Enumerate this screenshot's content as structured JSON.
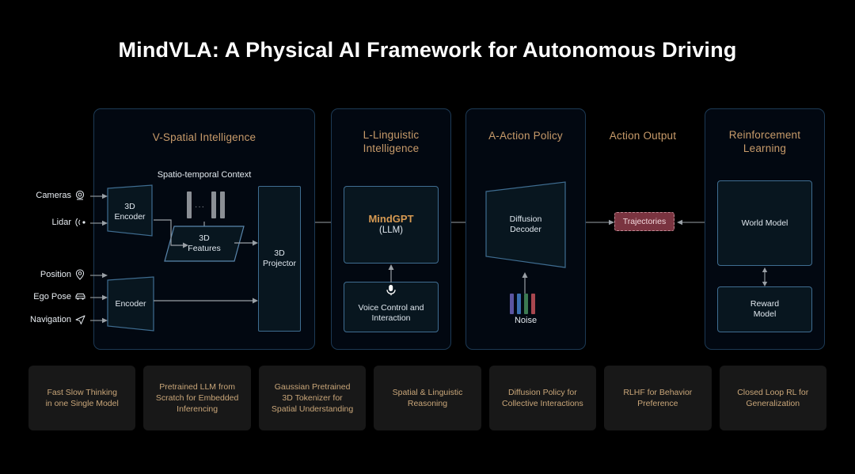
{
  "page": {
    "title": "MindVLA: A Physical AI Framework for Autonomous Driving",
    "background": "#000000"
  },
  "colors": {
    "accent_gold": "#c89b6a",
    "panel_bg": "#020811",
    "panel_border": "#1d3a55",
    "node_border": "#3f6d91",
    "node_bg": "#08161f",
    "text": "#dfe7ee",
    "trajectory_bg": "#7a3440",
    "card_bg": "#181818",
    "card_text": "#c9a679"
  },
  "inputs": [
    {
      "label": "Cameras",
      "icon": "camera-icon"
    },
    {
      "label": "Lidar",
      "icon": "lidar-icon"
    },
    {
      "label": "Position",
      "icon": "location-pin-icon"
    },
    {
      "label": "Ego Pose",
      "icon": "car-icon"
    },
    {
      "label": "Navigation",
      "icon": "navigation-arrow-icon"
    }
  ],
  "stages": {
    "spatial": {
      "title": "V-Spatial Intelligence",
      "context_label": "Spatio-temporal Context",
      "nodes": {
        "encoder_3d": "3D\nEncoder",
        "encoder_3d_l1": "3D",
        "encoder_3d_l2": "Encoder",
        "encoder_l1": "Encoder",
        "features_l1": "3D",
        "features_l2": "Features",
        "projector_l1": "3D",
        "projector_l2": "Projector"
      },
      "token_dots": "···"
    },
    "linguistic": {
      "title_l1": "L-Linguistic",
      "title_l2": "Intelligence",
      "model_name": "MindGPT",
      "model_sub": "(LLM)",
      "voice_l1": "Voice Control and",
      "voice_l2": "Interaction",
      "voice_icon": "microphone-icon"
    },
    "action": {
      "title": "A-Action Policy",
      "decoder_l1": "Diffusion",
      "decoder_l2": "Decoder",
      "noise_label": "Noise",
      "noise_colors": [
        "#5b55a0",
        "#3a6fb0",
        "#3c7a52",
        "#a8474f"
      ]
    },
    "output": {
      "title": "Action Output",
      "chip_label": "Trajectories"
    },
    "rl": {
      "title_l1": "Reinforcement",
      "title_l2": "Learning",
      "world_model": "World Model",
      "reward_l1": "Reward",
      "reward_l2": "Model"
    }
  },
  "cards": [
    {
      "l1": "Fast Slow Thinking",
      "l2": "in one Single Model",
      "l3": ""
    },
    {
      "l1": "Pretrained LLM from",
      "l2": "Scratch for Embedded",
      "l3": "Inferencing"
    },
    {
      "l1": "Gaussian Pretrained",
      "l2": "3D Tokenizer for",
      "l3": "Spatial Understanding"
    },
    {
      "l1": "Spatial & Linguistic",
      "l2": "Reasoning",
      "l3": ""
    },
    {
      "l1": "Diffusion Policy for",
      "l2": "Collective Interactions",
      "l3": ""
    },
    {
      "l1": "RLHF for Behavior",
      "l2": "Preference",
      "l3": ""
    },
    {
      "l1": "Closed Loop RL for",
      "l2": "Generalization",
      "l3": ""
    }
  ]
}
